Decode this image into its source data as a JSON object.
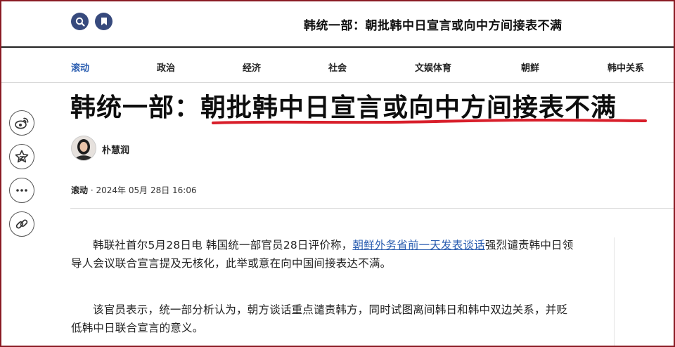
{
  "header": {
    "title": "韩统一部：朝批韩中日宣言或向中方间接表不满",
    "icons": [
      "search-icon",
      "bookmark-icon"
    ]
  },
  "nav": {
    "items": [
      {
        "label": "滚动",
        "active": true
      },
      {
        "label": "政治",
        "active": false
      },
      {
        "label": "经济",
        "active": false
      },
      {
        "label": "社会",
        "active": false
      },
      {
        "label": "文娱体育",
        "active": false
      },
      {
        "label": "朝鲜",
        "active": false
      },
      {
        "label": "韩中关系",
        "active": false
      }
    ]
  },
  "share": {
    "icons": [
      "weibo-icon",
      "star-favorite-icon",
      "more-icon",
      "link-icon"
    ]
  },
  "article": {
    "headline": "韩统一部：朝批韩中日宣言或向中方间接表不满",
    "author": "朴慧润",
    "category": "滚动",
    "date_sep": "·",
    "date": "2024年 05月 28日 16:06",
    "paragraphs": [
      {
        "before": "韩联社首尔5月28日电 韩国统一部官员28日评价称，",
        "link": "朝鲜外务省前一天发表谈话",
        "after": "强烈谴责韩中日领导人会议联合宣言提及无核化，此举或意在向中国间接表达不满。"
      },
      {
        "before": "该官员表示，统一部分析认为，朝方谈话重点谴责韩方，同时试图离间韩日和韩中双边关系，并贬低韩中日联合宣言的意义。",
        "link": "",
        "after": ""
      }
    ]
  },
  "colors": {
    "accent_blue": "#2a5db0",
    "icon_navy": "#374a7d",
    "frame": "#8a1b24",
    "highlight_red": "#d81e2a"
  }
}
